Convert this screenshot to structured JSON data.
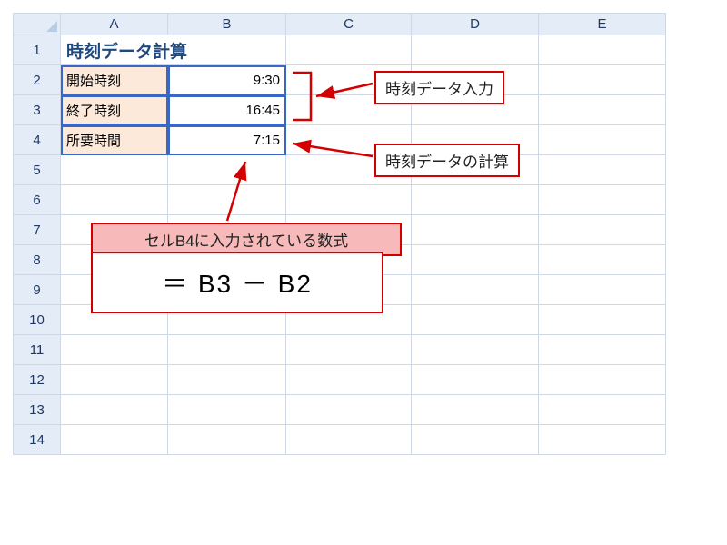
{
  "columns": [
    "A",
    "B",
    "C",
    "D",
    "E"
  ],
  "rows": [
    "1",
    "2",
    "3",
    "4",
    "5",
    "6",
    "7",
    "8",
    "9",
    "10",
    "11",
    "12",
    "13",
    "14"
  ],
  "cells": {
    "A1": "時刻データ計算",
    "A2": "開始時刻",
    "B2": "9:30",
    "A3": "終了時刻",
    "B3": "16:45",
    "A4": "所要時間",
    "B4": "7:15"
  },
  "annotations": {
    "input_label": "時刻データ入力",
    "calc_label": "時刻データの計算",
    "formula_caption": "セルB4に入力されている数式",
    "formula": "＝ B3 － B2"
  },
  "chart_data": {
    "type": "table",
    "title": "時刻データ計算",
    "rows": [
      {
        "label": "開始時刻",
        "value": "9:30"
      },
      {
        "label": "終了時刻",
        "value": "16:45"
      },
      {
        "label": "所要時間",
        "value": "7:15",
        "formula": "= B3 - B2"
      }
    ]
  }
}
